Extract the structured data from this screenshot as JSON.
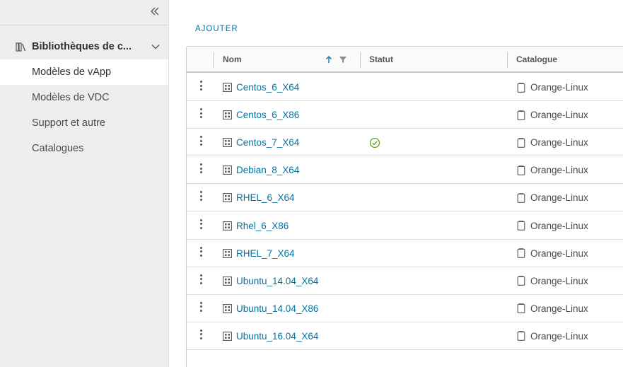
{
  "sidebar": {
    "group_label": "Bibliothèques de c...",
    "items": [
      {
        "label": "Modèles de vApp",
        "active": true
      },
      {
        "label": "Modèles de VDC",
        "active": false
      },
      {
        "label": "Support et autre",
        "active": false
      },
      {
        "label": "Catalogues",
        "active": false
      }
    ]
  },
  "toolbar": {
    "add_label": "AJOUTER"
  },
  "table": {
    "columns": {
      "name": "Nom",
      "status": "Statut",
      "catalog": "Catalogue"
    },
    "rows": [
      {
        "name": "Centos_6_X64",
        "status": "",
        "catalog": "Orange-Linux"
      },
      {
        "name": "Centos_6_X86",
        "status": "",
        "catalog": "Orange-Linux"
      },
      {
        "name": "Centos_7_X64",
        "status": "ok",
        "catalog": "Orange-Linux"
      },
      {
        "name": "Debian_8_X64",
        "status": "",
        "catalog": "Orange-Linux"
      },
      {
        "name": "RHEL_6_X64",
        "status": "",
        "catalog": "Orange-Linux"
      },
      {
        "name": "Rhel_6_X86",
        "status": "",
        "catalog": "Orange-Linux"
      },
      {
        "name": "RHEL_7_X64",
        "status": "",
        "catalog": "Orange-Linux"
      },
      {
        "name": "Ubuntu_14.04_X64",
        "status": "",
        "catalog": "Orange-Linux"
      },
      {
        "name": "Ubuntu_14.04_X86",
        "status": "",
        "catalog": "Orange-Linux"
      },
      {
        "name": "Ubuntu_16.04_X64",
        "status": "",
        "catalog": "Orange-Linux"
      }
    ]
  },
  "colors": {
    "link": "#0072a3",
    "status_ok": "#62a420",
    "sidebar_bg": "#eeeeee"
  },
  "icons": {
    "collapse": "double-chevron-left-icon",
    "library": "library-books-icon",
    "expand": "chevron-down-icon",
    "sort": "arrow-up-icon",
    "filter": "filter-icon",
    "row_actions": "kebab-menu-icon",
    "template": "vapp-template-icon",
    "status_ok": "check-circle-icon",
    "catalog": "catalog-icon"
  }
}
